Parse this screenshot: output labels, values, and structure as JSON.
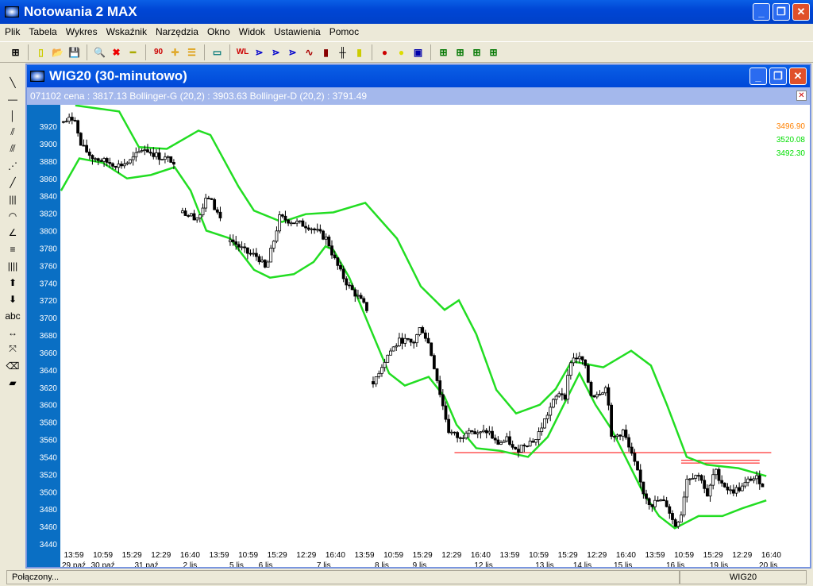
{
  "app": {
    "title": "Notowania 2 MAX"
  },
  "menu": [
    "Plik",
    "Tabela",
    "Wykres",
    "Wskaźnik",
    "Narzędzia",
    "Okno",
    "Widok",
    "Ustawienia",
    "Pomoc"
  ],
  "chart_window": {
    "title": "WIG20 (30-minutowo)",
    "info": "071102  cena : 3817.13 Bollinger-G (20,2) : 3903.63 Bollinger-D (20,2) : 3791.49"
  },
  "right_labels": [
    {
      "text": "3496.90",
      "color": "#ff8000"
    },
    {
      "text": "3520.08",
      "color": "#00dd00"
    },
    {
      "text": "3492.30",
      "color": "#00dd00"
    }
  ],
  "status": {
    "left": "Połączony...",
    "right": "WIG20"
  },
  "left_tools": [
    "abc"
  ],
  "chart_data": {
    "type": "candlestick",
    "ylim": [
      3430,
      3945
    ],
    "yticks": [
      3920,
      3900,
      3880,
      3860,
      3840,
      3820,
      3800,
      3780,
      3760,
      3740,
      3720,
      3700,
      3680,
      3660,
      3640,
      3620,
      3600,
      3580,
      3560,
      3540,
      3520,
      3500,
      3480,
      3460,
      3440
    ],
    "xtick_times": [
      "13:59",
      "10:59",
      "15:29",
      "12:29",
      "16:40",
      "13:59",
      "10:59",
      "15:29",
      "12:29",
      "16:40",
      "13:59",
      "10:59",
      "15:29",
      "12:29",
      "16:40",
      "13:59",
      "10:59",
      "15:29",
      "12:29",
      "16:40",
      "13:59",
      "10:59",
      "15:29",
      "12:29",
      "16:40"
    ],
    "xtick_dates": [
      {
        "i": 0,
        "t": "29 paź"
      },
      {
        "i": 1,
        "t": "30 paź"
      },
      {
        "i": 2.5,
        "t": "31 paź"
      },
      {
        "i": 4,
        "t": "2 lis"
      },
      {
        "i": 5.6,
        "t": "5 lis"
      },
      {
        "i": 6.6,
        "t": "6 lis"
      },
      {
        "i": 8.6,
        "t": "7 lis"
      },
      {
        "i": 10.6,
        "t": "8 lis"
      },
      {
        "i": 11.9,
        "t": "9 lis"
      },
      {
        "i": 14.1,
        "t": "12 lis"
      },
      {
        "i": 16.2,
        "t": "13 lis"
      },
      {
        "i": 17.5,
        "t": "14 lis"
      },
      {
        "i": 18.9,
        "t": "15 lis"
      },
      {
        "i": 20.7,
        "t": "16 lis"
      },
      {
        "i": 22.2,
        "t": "19 lis"
      },
      {
        "i": 23.9,
        "t": "20 lis"
      }
    ],
    "price": [
      [
        -0.36,
        3925
      ],
      [
        0.05,
        3930
      ],
      [
        0.19,
        3900
      ],
      [
        0.6,
        3885
      ],
      [
        1.0,
        3880
      ],
      [
        1.56,
        3875
      ],
      [
        1.97,
        3880
      ],
      [
        2.38,
        3895
      ],
      [
        2.92,
        3885
      ],
      [
        3.47,
        3880
      ],
      null,
      [
        3.74,
        3820
      ],
      [
        4.29,
        3815
      ],
      [
        4.62,
        3840
      ],
      [
        5.11,
        3810
      ],
      null,
      [
        5.38,
        3790
      ],
      [
        5.93,
        3775
      ],
      [
        6.34,
        3770
      ],
      [
        6.61,
        3755
      ],
      [
        6.89,
        3790
      ],
      [
        7.08,
        3815
      ],
      [
        7.57,
        3810
      ],
      [
        8.11,
        3805
      ],
      [
        8.52,
        3795
      ],
      [
        8.72,
        3790
      ],
      [
        8.93,
        3770
      ],
      [
        9.21,
        3750
      ],
      [
        9.48,
        3735
      ],
      [
        9.75,
        3725
      ],
      [
        10.08,
        3710
      ],
      null,
      [
        10.3,
        3625
      ],
      [
        10.52,
        3640
      ],
      [
        10.85,
        3660
      ],
      [
        11.26,
        3675
      ],
      [
        11.67,
        3670
      ],
      [
        11.94,
        3690
      ],
      [
        12.21,
        3670
      ],
      [
        12.43,
        3640
      ],
      [
        12.62,
        3610
      ],
      [
        12.9,
        3570
      ],
      [
        13.31,
        3560
      ],
      [
        13.58,
        3575
      ],
      [
        13.85,
        3565
      ],
      [
        14.26,
        3570
      ],
      [
        14.54,
        3555
      ],
      [
        14.95,
        3560
      ],
      [
        15.16,
        3545
      ],
      [
        15.49,
        3555
      ],
      [
        15.9,
        3560
      ],
      [
        16.17,
        3580
      ],
      [
        16.45,
        3600
      ],
      [
        16.72,
        3615
      ],
      [
        16.91,
        3610
      ],
      [
        17.08,
        3650
      ],
      [
        17.27,
        3655
      ],
      [
        17.54,
        3650
      ],
      [
        17.81,
        3610
      ],
      [
        18.09,
        3615
      ],
      [
        18.36,
        3620
      ],
      [
        18.5,
        3560
      ],
      [
        18.91,
        3570
      ],
      [
        19.1,
        3550
      ],
      [
        19.32,
        3530
      ],
      [
        19.59,
        3500
      ],
      [
        19.86,
        3485
      ],
      [
        20.14,
        3490
      ],
      [
        20.41,
        3485
      ],
      [
        20.68,
        3460
      ],
      [
        20.9,
        3475
      ],
      [
        21.09,
        3515
      ],
      [
        21.37,
        3520
      ],
      [
        21.64,
        3515
      ],
      [
        21.78,
        3490
      ],
      [
        22.05,
        3525
      ],
      [
        22.32,
        3510
      ],
      [
        22.6,
        3500
      ],
      [
        23.01,
        3505
      ],
      [
        23.28,
        3515
      ],
      [
        23.55,
        3515
      ],
      [
        23.77,
        3505
      ]
    ],
    "bollinger_upper": [
      [
        0.05,
        3944
      ],
      [
        1.56,
        3937
      ],
      [
        2.24,
        3896
      ],
      [
        3.2,
        3894
      ],
      [
        4.29,
        3915
      ],
      [
        4.7,
        3910
      ],
      [
        5.66,
        3851
      ],
      [
        6.2,
        3823
      ],
      [
        7.16,
        3810
      ],
      [
        7.98,
        3819
      ],
      [
        8.93,
        3821
      ],
      [
        10.03,
        3832
      ],
      [
        11.12,
        3791
      ],
      [
        11.94,
        3736
      ],
      [
        12.76,
        3709
      ],
      [
        13.25,
        3720
      ],
      [
        13.85,
        3681
      ],
      [
        14.54,
        3617
      ],
      [
        15.22,
        3590
      ],
      [
        16.04,
        3600
      ],
      [
        16.58,
        3618
      ],
      [
        17.13,
        3650
      ],
      [
        18.22,
        3643
      ],
      [
        19.18,
        3662
      ],
      [
        19.86,
        3645
      ],
      [
        20.41,
        3600
      ],
      [
        21.09,
        3540
      ],
      [
        21.78,
        3531
      ],
      [
        22.87,
        3527
      ],
      [
        23.83,
        3518
      ]
    ],
    "bollinger_lower": [
      [
        -0.44,
        3846
      ],
      [
        0.19,
        3883
      ],
      [
        1.0,
        3878
      ],
      [
        1.83,
        3860
      ],
      [
        2.65,
        3864
      ],
      [
        3.47,
        3873
      ],
      [
        4.02,
        3846
      ],
      [
        4.56,
        3800
      ],
      [
        5.38,
        3791
      ],
      [
        6.2,
        3755
      ],
      [
        6.75,
        3746
      ],
      [
        7.57,
        3750
      ],
      [
        8.25,
        3764
      ],
      [
        8.66,
        3782
      ],
      [
        8.93,
        3778
      ],
      [
        9.48,
        3746
      ],
      [
        10.16,
        3691
      ],
      [
        10.85,
        3636
      ],
      [
        11.39,
        3622
      ],
      [
        12.21,
        3632
      ],
      [
        12.76,
        3609
      ],
      [
        13.17,
        3577
      ],
      [
        13.85,
        3550
      ],
      [
        14.67,
        3547
      ],
      [
        15.63,
        3540
      ],
      [
        16.31,
        3563
      ],
      [
        16.86,
        3600
      ],
      [
        17.4,
        3636
      ],
      [
        17.95,
        3600
      ],
      [
        18.5,
        3572
      ],
      [
        19.04,
        3536
      ],
      [
        19.59,
        3499
      ],
      [
        20.14,
        3472
      ],
      [
        20.68,
        3458
      ],
      [
        21.5,
        3472
      ],
      [
        22.32,
        3472
      ],
      [
        23.01,
        3481
      ],
      [
        23.83,
        3490
      ]
    ],
    "hlines": [
      {
        "y": 3545,
        "from": 13.1,
        "to": 24.0
      },
      {
        "y": 3536,
        "from": 20.9,
        "to": 23.6
      },
      {
        "y": 3533,
        "from": 20.9,
        "to": 23.6
      }
    ],
    "colors": {
      "band": "#22dd22",
      "price": "#000000",
      "hline": "#ff0000"
    }
  }
}
